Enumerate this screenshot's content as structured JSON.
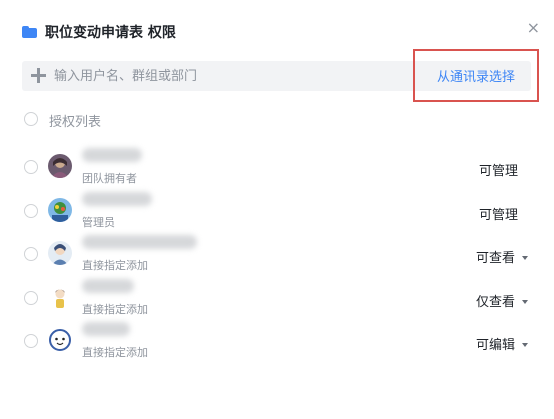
{
  "dialog": {
    "title": "职位变动申请表 权限",
    "close_glyph": "×"
  },
  "search": {
    "placeholder": "输入用户名、群组或部门",
    "contact_button": "从通讯录选择"
  },
  "list": {
    "section_label": "授权列表",
    "rows": [
      {
        "role": "团队拥有者",
        "permission": "可管理",
        "has_dropdown": false
      },
      {
        "role": "管理员",
        "permission": "可管理",
        "has_dropdown": false
      },
      {
        "role": "直接指定添加",
        "permission": "可查看",
        "has_dropdown": true
      },
      {
        "role": "直接指定添加",
        "permission": "仅查看",
        "has_dropdown": true
      },
      {
        "role": "直接指定添加",
        "permission": "可编辑",
        "has_dropdown": true
      }
    ]
  },
  "colors": {
    "accent": "#3e86f5",
    "highlight_border": "#d9534f",
    "muted_text": "#8f959e"
  }
}
